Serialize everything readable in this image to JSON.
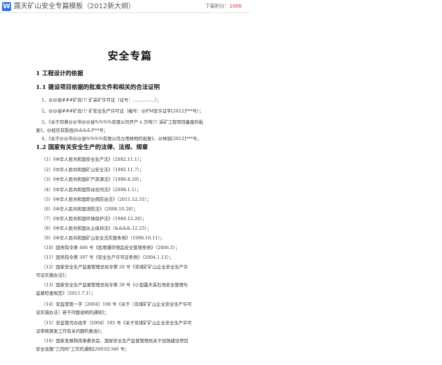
{
  "header": {
    "app_icon": "word-icon",
    "doc_title": "露天矿山安全专篇模板（2012新大纲）",
    "download_label": "下载积分：",
    "download_points": "1000"
  },
  "document": {
    "title": "安全专篇",
    "section1": "1  工程设计的依据",
    "section1_1": "1.1 建设项目依据的批准文件和相关的合法证明",
    "s11_lines": [
      "1、@@县###矿段!!! 矿采矿许可证（证号：……………）；",
      "2、@@县###矿段!!! 矿安全生产许可证（编号：@FM安许证字[2012]***号）；",
      "3、《关于同意@@市@@县%%%%有限公司开产 x 万吨!!! 采矿工程项目备案的批",
      "复》，@经信非投函[&&&&]***号；",
      "4、《关于@@市@@县%%%%有限公司占用林地的批复》，@林容[2012]***号。"
    ],
    "section1_2": "1.2 国家有关安全生产的法律、法规、规章",
    "s12_lines": [
      "（1）《中华人民共和国安全生产法》（2002.11.1）；",
      "（2）《中华人民共和国矿山安全法》（1992.11.7）；",
      "（3）《中华人民共和国矿产资源法》（1996.8.29）；",
      "（4）《中华人民共和国劳动合同法》（2008.1.1）；",
      "（5）《中华人民共和国职业病防治法》（2011.12.31）；",
      "（6）《中华人民共和国消防法》（2008.10.28）；",
      "（7）《中华人民共和国环境保护法》（1989.12.26）；",
      "（8）《中华人民共和国水土保持法》（&&&&.12.25）；",
      "（9）《中华人民共和国矿山安全法实施条例》（1996.10.11）；",
      "（10）国务院令第 466 号《民用爆炸物品安全管理条例》（2006.5）；",
      "（11）国务院令第 397 号《安全生产许可证条例》（2004.1.13）；",
      "（12）国家安全生产监督管理总局令第 20 号《非煤矿矿山企业安全生产许",
      "可证实施办法》；",
      "（13）国家安全生产监督管理总局令第 39 号《小型露天采石场安全管理与",
      "监督检查规定》（2011.7.1）；",
      "（14）安监管管一字［2004］100 号《关于〈非煤矿矿山企业安全生产许可",
      "证实施办法〉若干问题说明的通知》；",
      "（15）安监管司办函字（2004）185 号《关于非煤矿矿山企业安全生产许可",
      "证审核颁发工作有关问题的复函》；",
      "（16）国家发展和改革委员会、国家安全生产监督管理局关于加强建设项目",
      "安全设施\"三同时\"工作的通知[2003]1346 号；"
    ]
  }
}
